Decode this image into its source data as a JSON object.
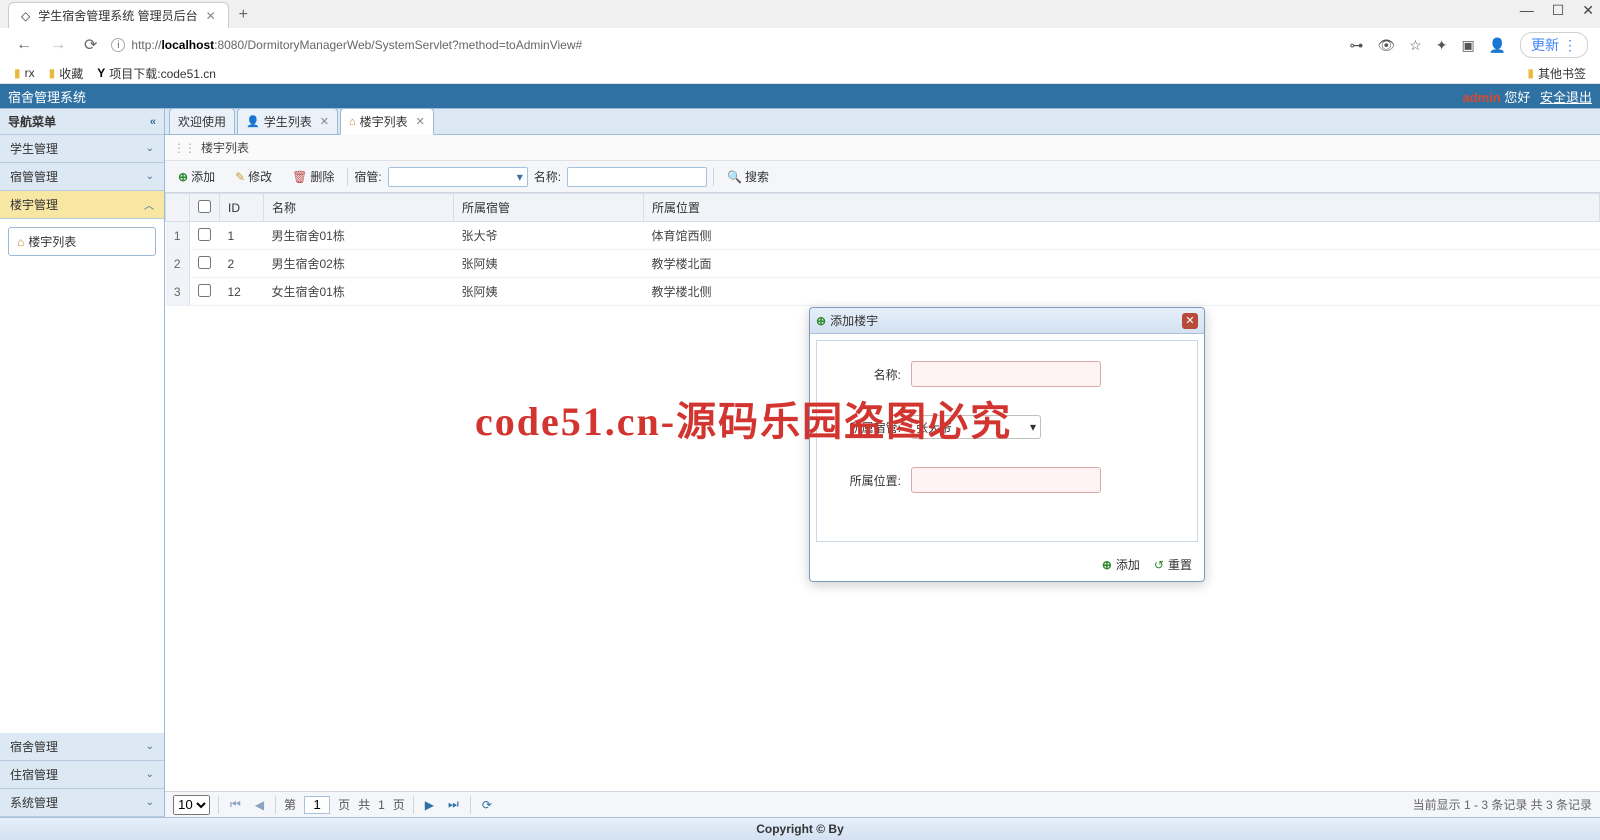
{
  "browser": {
    "tab_title": "学生宿舍管理系统 管理员后台",
    "url_protocol": "http://",
    "url_host": "localhost",
    "url_rest": ":8080/DormitoryManagerWeb/SystemServlet?method=toAdminView#",
    "update_label": "更新",
    "bookmarks": [
      {
        "icon": "folder",
        "label": "rx"
      },
      {
        "icon": "folder",
        "label": "收藏"
      },
      {
        "icon": "y",
        "label": "项目下载:code51.cn"
      }
    ],
    "bookmark_right": "其他书签"
  },
  "header": {
    "title": "宿舍管理系统",
    "user": "admin",
    "greeting": "您好",
    "logout": "安全退出"
  },
  "sidebar": {
    "title": "导航菜单",
    "groups": [
      {
        "label": "学生管理",
        "active": false
      },
      {
        "label": "宿管管理",
        "active": false
      },
      {
        "label": "楼宇管理",
        "active": true,
        "children": [
          {
            "label": "楼宇列表"
          }
        ]
      },
      {
        "label": "宿舍管理",
        "active": false
      },
      {
        "label": "住宿管理",
        "active": false
      },
      {
        "label": "系统管理",
        "active": false
      }
    ]
  },
  "tabs": [
    {
      "label": "欢迎使用",
      "icon": "",
      "closable": false,
      "active": false
    },
    {
      "label": "学生列表",
      "icon": "user",
      "closable": true,
      "active": false
    },
    {
      "label": "楼宇列表",
      "icon": "home",
      "closable": true,
      "active": true
    }
  ],
  "panel_title": "楼宇列表",
  "toolbar": {
    "add": "添加",
    "edit": "修改",
    "del": "删除",
    "filter1_label": "宿管:",
    "filter2_label": "名称:",
    "search": "搜索"
  },
  "grid": {
    "headers": {
      "id": "ID",
      "name": "名称",
      "manager": "所属宿管",
      "location": "所属位置"
    },
    "rows": [
      {
        "n": "1",
        "id": "1",
        "name": "男生宿舍01栋",
        "manager": "张大爷",
        "location": "体育馆西侧"
      },
      {
        "n": "2",
        "id": "2",
        "name": "男生宿舍02栋",
        "manager": "张阿姨",
        "location": "教学楼北面"
      },
      {
        "n": "3",
        "id": "12",
        "name": "女生宿舍01栋",
        "manager": "张阿姨",
        "location": "教学楼北侧"
      }
    ]
  },
  "dialog": {
    "title": "添加楼宇",
    "fields": {
      "name_label": "名称:",
      "manager_label": "所属宿管:",
      "manager_value": "张大爷",
      "location_label": "所属位置:"
    },
    "btn_add": "添加",
    "btn_reset": "重置"
  },
  "pager": {
    "size": "10",
    "page": "1",
    "total_pages": "1",
    "page_word": "页",
    "first_word": "第",
    "gong": "共",
    "status": "当前显示 1 - 3 条记录 共 3 条记录"
  },
  "footer": "Copyright © By",
  "watermark": "code51.cn-源码乐园盗图必究"
}
